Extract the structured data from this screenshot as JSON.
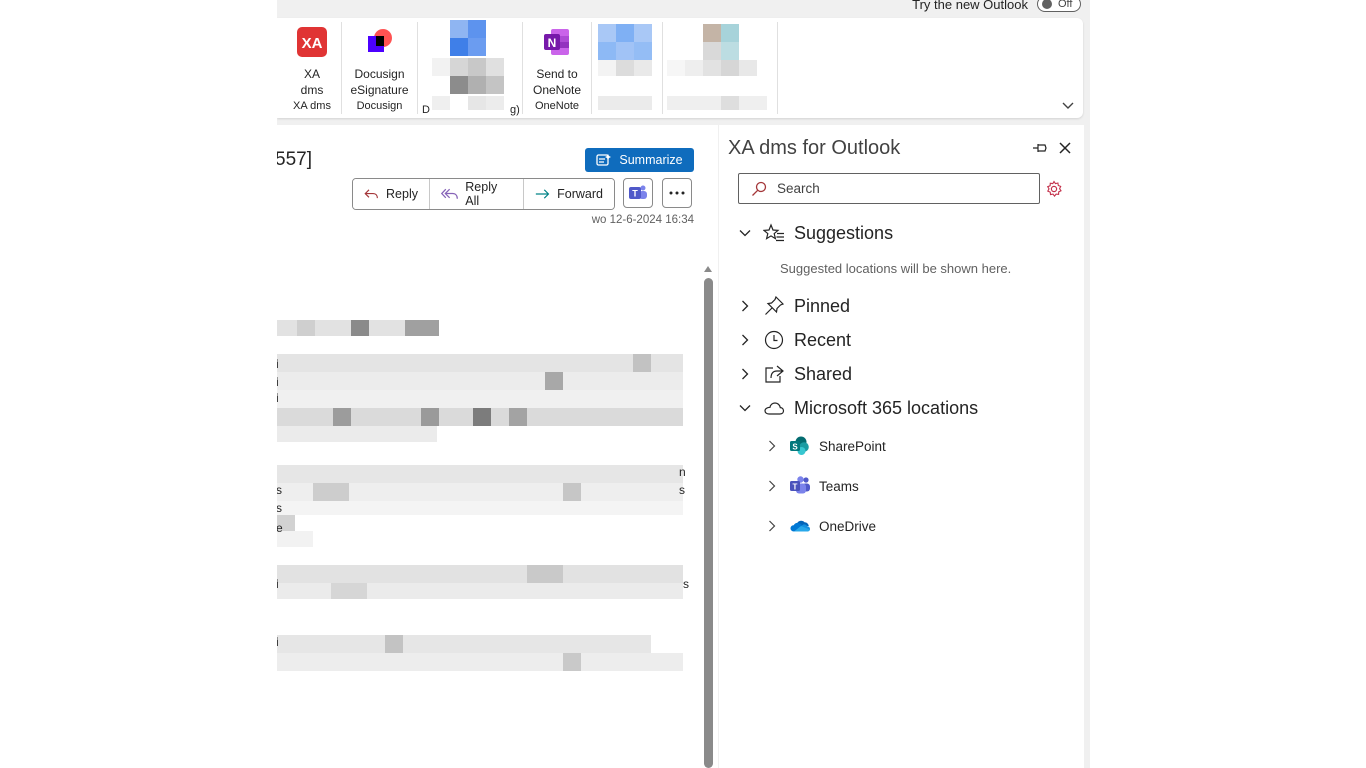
{
  "topbar": {
    "try_new_outlook": "Try the new Outlook",
    "toggle_state": "Off"
  },
  "ribbon": {
    "groups": [
      {
        "button_label_1": "XA",
        "button_label_2": "dms",
        "group_label": "XA dms",
        "icon": "xa-dms-icon",
        "icon_color": "#e03434"
      },
      {
        "button_label_1": "Docusign",
        "button_label_2": "eSignature",
        "group_label": "Docusign",
        "icon": "docusign-icon"
      },
      {
        "group_label_fragment_left": "D",
        "group_label_fragment_right": "g)"
      },
      {
        "button_label_1": "Send to",
        "button_label_2": "OneNote",
        "group_label": "OneNote",
        "icon": "onenote-icon",
        "icon_color": "#7719aa"
      }
    ]
  },
  "message": {
    "subject_fragment": "557]",
    "summarize_label": "Summarize",
    "reply_label": "Reply",
    "reply_all_label": "Reply All",
    "forward_label": "Forward",
    "date": "wo 12-6-2024 16:34",
    "edge_chars": [
      "i",
      "i",
      "i",
      "n",
      "s",
      "s",
      "s",
      "e",
      "i",
      "s",
      "i"
    ]
  },
  "addin": {
    "title": "XA dms for Outlook",
    "search_placeholder": "Search",
    "sections": {
      "suggestions": "Suggestions",
      "suggestions_hint": "Suggested locations will be shown here.",
      "pinned": "Pinned",
      "recent": "Recent",
      "shared": "Shared",
      "m365": "Microsoft 365 locations"
    },
    "locations": [
      {
        "label": "SharePoint",
        "icon": "sharepoint-icon"
      },
      {
        "label": "Teams",
        "icon": "teams-icon"
      },
      {
        "label": "OneDrive",
        "icon": "onedrive-icon"
      }
    ]
  },
  "colors": {
    "accent": "#0f6cbd",
    "xa_red": "#e03434",
    "gear_red": "#c4314b"
  }
}
